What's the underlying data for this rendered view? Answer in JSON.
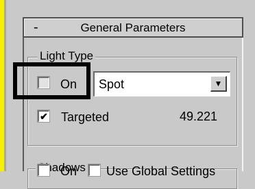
{
  "rollout": {
    "collapse_symbol": "-",
    "title": "General Parameters"
  },
  "light_type": {
    "group_label": "Light Type",
    "on_label": "On",
    "on_checked": false,
    "type_value": "Spot",
    "targeted_label": "Targeted",
    "targeted_checked": true,
    "targeted_value": "49.221"
  },
  "shadows": {
    "group_label": "Shadows",
    "on_label": "On",
    "use_global_label": "Use Global Settings"
  },
  "icons": {
    "checkmark": "✔",
    "dropdown_arrow": "▼"
  }
}
